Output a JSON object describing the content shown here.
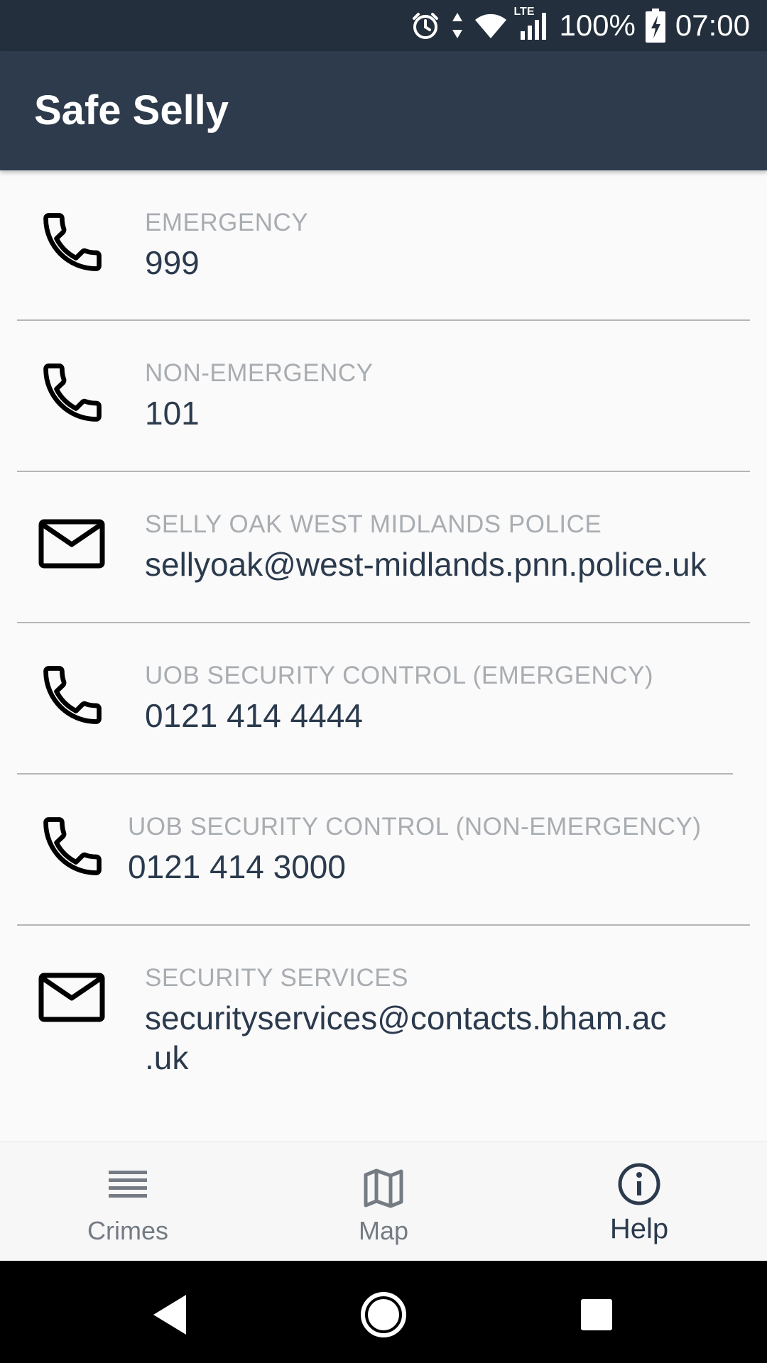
{
  "status_bar": {
    "battery": "100%",
    "time": "07:00",
    "network": "LTE",
    "icons": [
      "alarm-icon",
      "data-arrows-icon",
      "wifi-icon",
      "signal-icon",
      "battery-charging-icon"
    ]
  },
  "app_bar": {
    "title": "Safe Selly"
  },
  "contacts": [
    {
      "icon": "phone-icon",
      "label": "EMERGENCY",
      "value": "999"
    },
    {
      "icon": "phone-icon",
      "label": "NON-EMERGENCY",
      "value": "101"
    },
    {
      "icon": "mail-icon",
      "label": "SELLY OAK WEST MIDLANDS POLICE",
      "value": "sellyoak@west-midlands.pnn.police.uk"
    },
    {
      "icon": "phone-icon",
      "label": "UOB SECURITY CONTROL (EMERGENCY)",
      "value": "0121 414 4444"
    },
    {
      "icon": "phone-icon",
      "label": "UOB SECURITY CONTROL (NON-EMERGENCY)",
      "value": "0121 414 3000"
    },
    {
      "icon": "mail-icon",
      "label": "SECURITY SERVICES",
      "value_line1": "securityservices@contacts.bham.ac",
      "value_line2": ".uk"
    }
  ],
  "bottom_nav": {
    "items": [
      {
        "label": "Crimes",
        "icon": "list-icon",
        "active": false
      },
      {
        "label": "Map",
        "icon": "map-icon",
        "active": false
      },
      {
        "label": "Help",
        "icon": "info-icon",
        "active": true
      }
    ]
  },
  "system_nav": {
    "icons": [
      "back-icon",
      "home-icon",
      "recents-icon"
    ]
  },
  "colors": {
    "status_bar": "#232f3c",
    "app_bar": "#2d3b4c",
    "label": "#a9adb1",
    "value": "#2b3a4d",
    "nav_inactive": "#747b83"
  }
}
